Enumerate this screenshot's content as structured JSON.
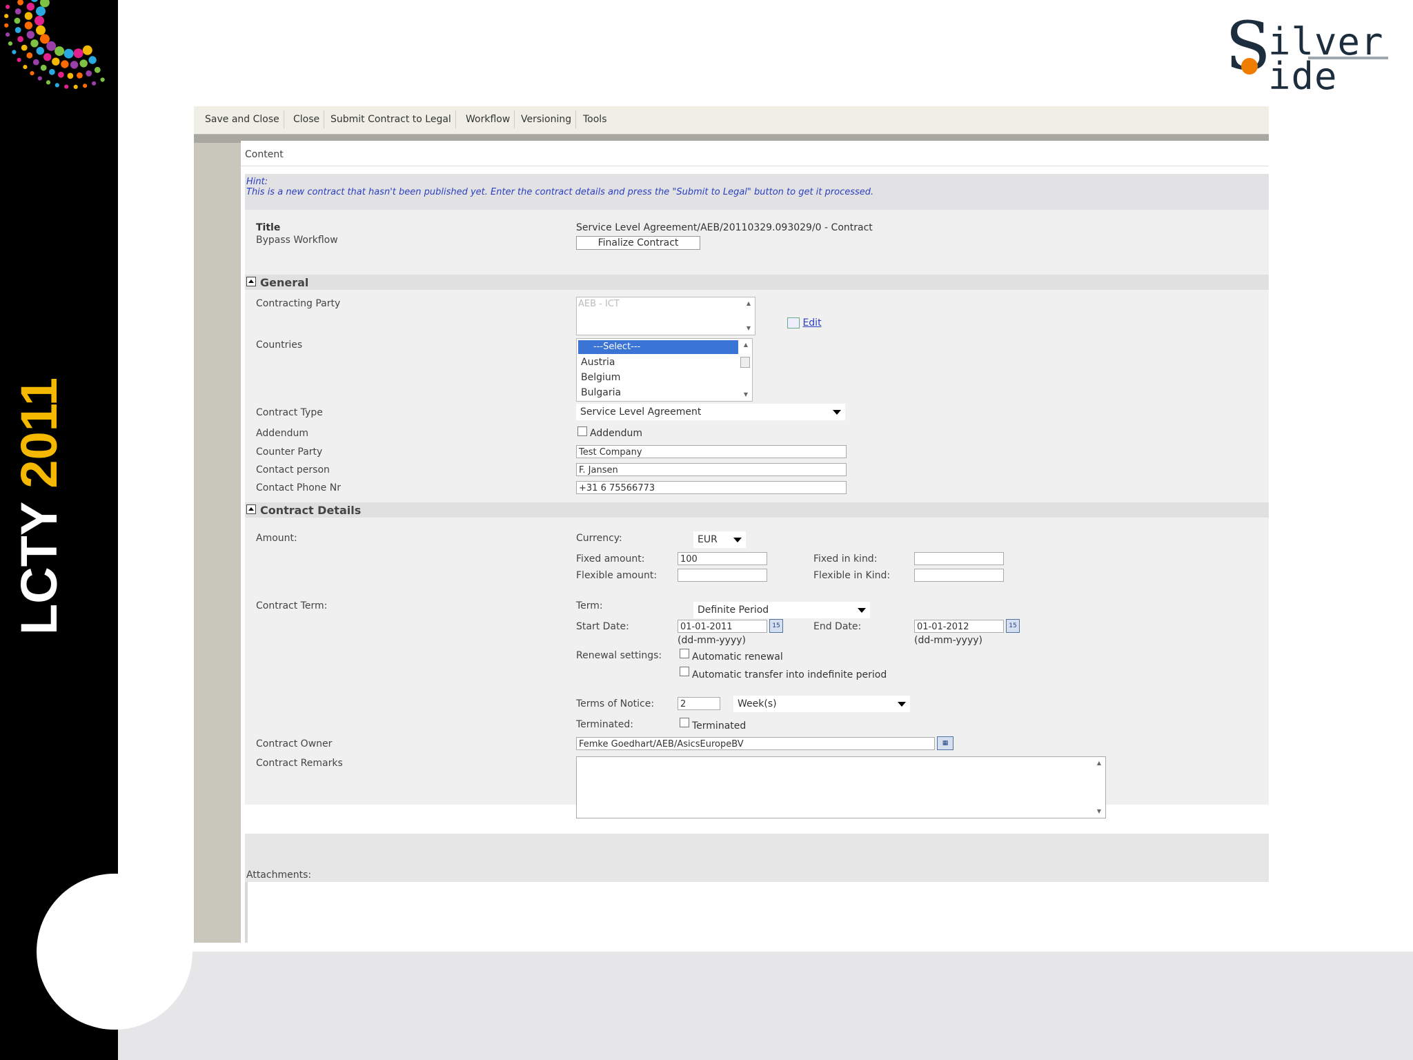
{
  "slide": {
    "side_label": "LCTY",
    "side_year": "2011",
    "logo": {
      "initial": "S",
      "line1": "ilver",
      "line2": "ide"
    },
    "accent_color": "#f5b800"
  },
  "toolbar": {
    "items": [
      "Save and Close",
      "Close",
      "Submit Contract to Legal",
      "Workflow",
      "Versioning",
      "Tools"
    ]
  },
  "content": {
    "tab_label": "Content",
    "hint_title": "Hint:",
    "hint_text": "This is a new contract that hasn't been published yet. Enter the contract details and press the \"Submit to Legal\" button to get it processed.",
    "title_label": "Title",
    "title_value": "Service Level Agreement/AEB/20110329.093029/0 - Contract",
    "bypass_label": "Bypass Workflow",
    "finalize_button": "Finalize Contract"
  },
  "general": {
    "heading": "General",
    "contracting_party_label": "Contracting Party",
    "contracting_party_value": "AEB - ICT",
    "edit_link": "Edit",
    "countries_label": "Countries",
    "countries_options": [
      "---Select---",
      "Austria",
      "Belgium",
      "Bulgaria"
    ],
    "contract_type_label": "Contract Type",
    "contract_type_value": "Service Level Agreement",
    "addendum_label": "Addendum",
    "addendum_checkbox_label": "Addendum",
    "counter_party_label": "Counter Party",
    "counter_party_value": "Test Company",
    "contact_person_label": "Contact person",
    "contact_person_value": "F. Jansen",
    "contact_phone_label": "Contact Phone Nr",
    "contact_phone_value": "+31 6 75566773"
  },
  "details": {
    "heading": "Contract Details",
    "amount_label": "Amount:",
    "currency_label": "Currency:",
    "currency_value": "EUR",
    "fixed_amount_label": "Fixed amount:",
    "fixed_amount_value": "100",
    "flexible_amount_label": "Flexible amount:",
    "fixed_kind_label": "Fixed in kind:",
    "flexible_kind_label": "Flexible in Kind:",
    "contract_term_label": "Contract Term:",
    "term_label": "Term:",
    "term_value": "Definite Period",
    "start_date_label": "Start Date:",
    "start_date_value": "01-01-2011",
    "end_date_label": "End Date:",
    "end_date_value": "01-01-2012",
    "date_format": "(dd-mm-yyyy)",
    "renewal_label": "Renewal settings:",
    "auto_renewal": "Automatic renewal",
    "auto_transfer": "Automatic transfer into indefinite period",
    "notice_label": "Terms of Notice:",
    "notice_value": "2",
    "notice_unit": "Week(s)",
    "terminated_label": "Terminated:",
    "terminated_checkbox_label": "Terminated",
    "owner_label": "Contract Owner",
    "owner_value": "Femke Goedhart/AEB/AsicsEuropeBV",
    "remarks_label": "Contract Remarks",
    "attachments_label": "Attachments:"
  }
}
